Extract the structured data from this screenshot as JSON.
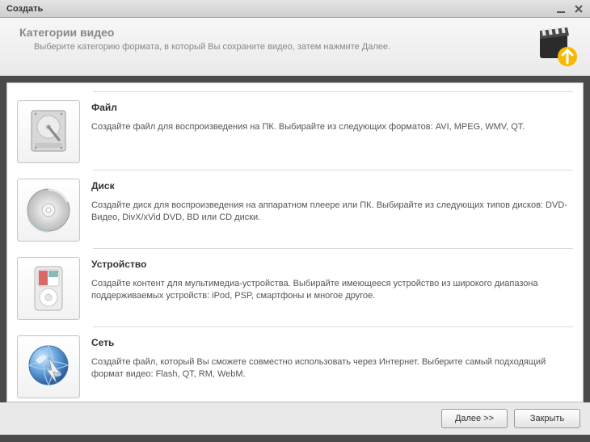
{
  "window": {
    "title": "Создать"
  },
  "header": {
    "title": "Категории видео",
    "subtitle": "Выберите категорию формата, в который Вы сохраните видео, затем нажмите Далее."
  },
  "categories": [
    {
      "icon": "hdd-icon",
      "title": "Файл",
      "description": "Создайте файл для воспроизведения на ПК. Выбирайте из следующих форматов: AVI, MPEG, WMV, QT."
    },
    {
      "icon": "disc-icon",
      "title": "Диск",
      "description": "Создайте диск для воспроизведения на аппаратном плеере или ПК. Выбирайте из следующих типов дисков: DVD-Видео, DivX/xVid DVD, BD или CD диски."
    },
    {
      "icon": "device-icon",
      "title": "Устройство",
      "description": "Создайте контент для мультимедиа-устройства. Выбирайте имеющееся устройство из широкого диапазона поддерживаемых устройств: iPod, PSP, смартфоны и многое другое."
    },
    {
      "icon": "network-icon",
      "title": "Сеть",
      "description": "Создайте файл, который Вы сможете совместно использовать через Интернет. Выберите самый подходящий формат видео: Flash, QT, RM, WebM."
    }
  ],
  "footer": {
    "next_label": "Далее >>",
    "close_label": "Закрыть"
  }
}
